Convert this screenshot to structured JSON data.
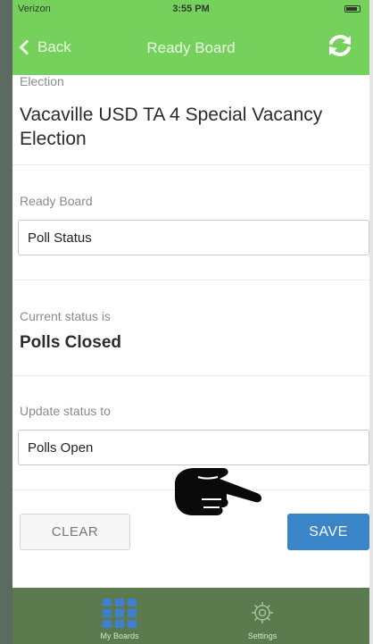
{
  "status_bar": {
    "carrier": "Verizon",
    "time": "3:55 PM"
  },
  "nav": {
    "back_label": "Back",
    "title": "Ready Board"
  },
  "election": {
    "label": "Election",
    "name": "Vacaville USD TA 4 Special Vacancy Election"
  },
  "ready_board": {
    "label": "Ready Board",
    "value": "Poll Status"
  },
  "current_status": {
    "label": "Current status is",
    "value": "Polls Closed"
  },
  "update_status": {
    "label": "Update status to",
    "value": "Polls Open"
  },
  "actions": {
    "clear_label": "CLEAR",
    "save_label": "SAVE"
  },
  "tabs": [
    {
      "label": "My Boards",
      "icon": "grid-icon"
    },
    {
      "label": "Settings",
      "icon": "gear-icon"
    }
  ],
  "colors": {
    "header": "#76d15c",
    "tabbar": "#5b7a4e",
    "save_button": "#3a84c8",
    "tab_icon_active": "#3f7fd1"
  }
}
